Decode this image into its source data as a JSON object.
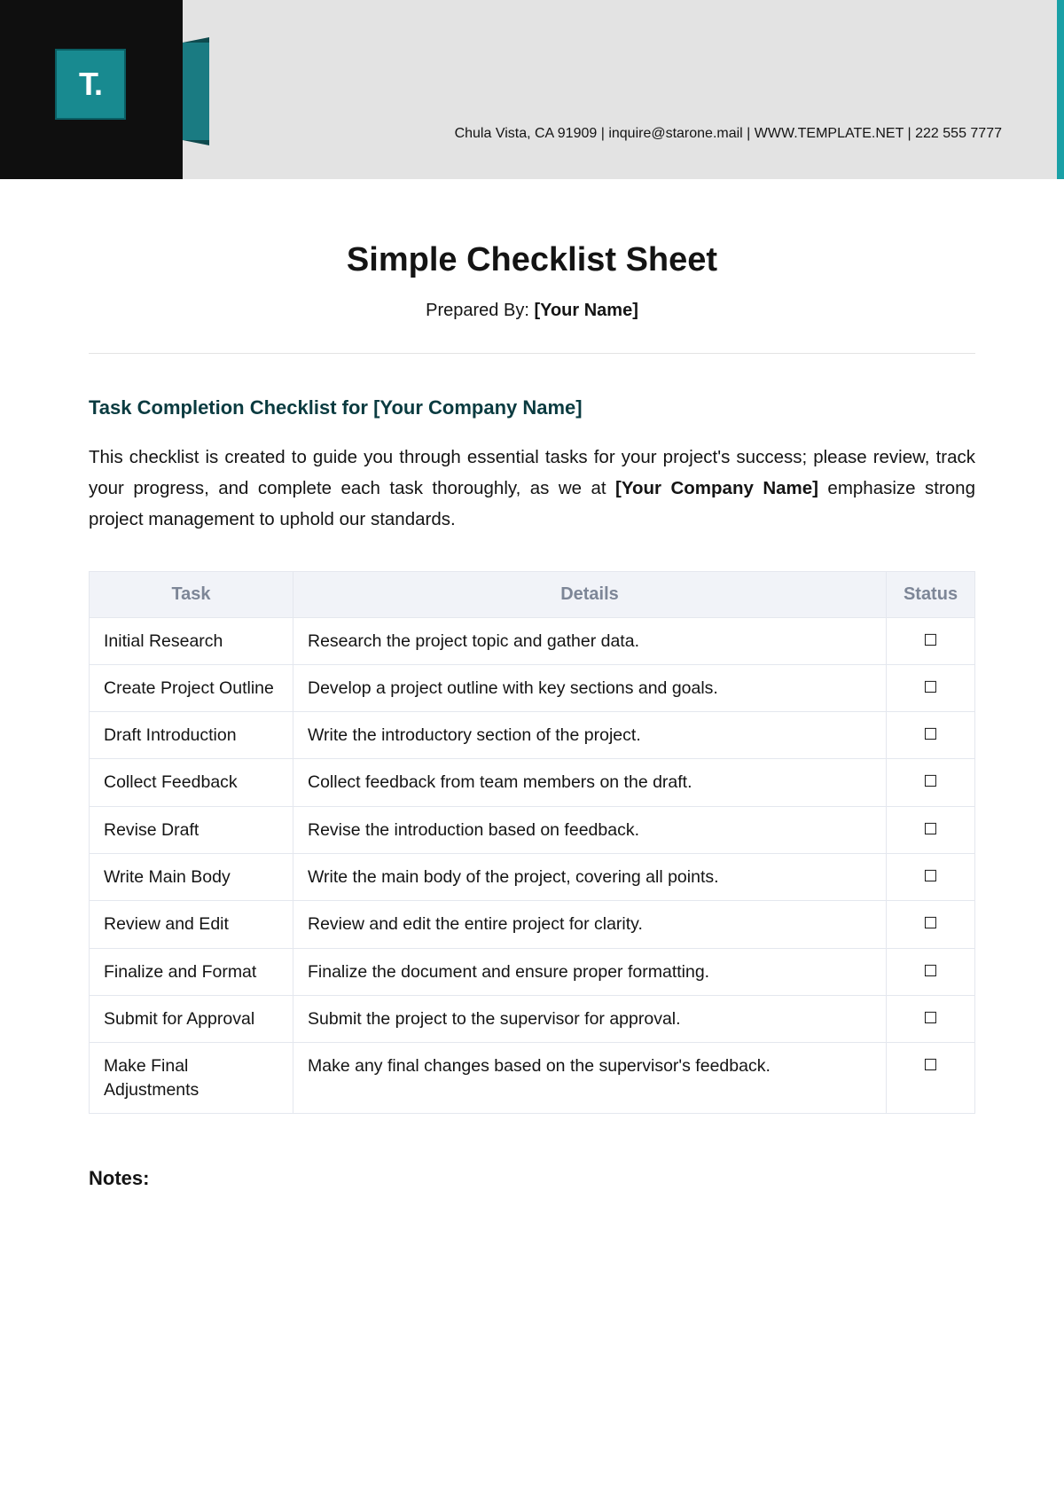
{
  "logo": {
    "letter": "T."
  },
  "contact": "Chula Vista, CA 91909 | inquire@starone.mail | WWW.TEMPLATE.NET | 222 555 7777",
  "title": "Simple Checklist Sheet",
  "prepared_by_label": "Prepared By: ",
  "prepared_by_value": "[Your Name]",
  "section_heading": "Task Completion Checklist for [Your Company Name]",
  "intro_prefix": "This checklist is created to guide you through essential tasks for your project's success; please review, track your progress, and complete each task thoroughly, as we at ",
  "intro_bold": "[Your Company Name]",
  "intro_suffix": " emphasize strong project management to uphold our standards.",
  "table": {
    "headers": {
      "task": "Task",
      "details": "Details",
      "status": "Status"
    },
    "rows": [
      {
        "task": "Initial Research",
        "details": "Research the project topic and gather data.",
        "status": "☐"
      },
      {
        "task": "Create Project Outline",
        "details": "Develop a project outline with key sections and goals.",
        "status": "☐"
      },
      {
        "task": "Draft Introduction",
        "details": "Write the introductory section of the project.",
        "status": "☐"
      },
      {
        "task": "Collect Feedback",
        "details": "Collect feedback from team members on the draft.",
        "status": "☐"
      },
      {
        "task": "Revise Draft",
        "details": "Revise the introduction based on feedback.",
        "status": "☐"
      },
      {
        "task": "Write Main Body",
        "details": "Write the main body of the project, covering all points.",
        "status": "☐"
      },
      {
        "task": "Review and Edit",
        "details": "Review and edit the entire project for clarity.",
        "status": "☐"
      },
      {
        "task": "Finalize and Format",
        "details": "Finalize the document and ensure proper formatting.",
        "status": "☐"
      },
      {
        "task": "Submit for Approval",
        "details": "Submit the project to the supervisor for approval.",
        "status": "☐"
      },
      {
        "task": "Make Final Adjustments",
        "details": "Make any final changes based on the supervisor's feedback.",
        "status": "☐"
      }
    ]
  },
  "notes_label": "Notes:"
}
